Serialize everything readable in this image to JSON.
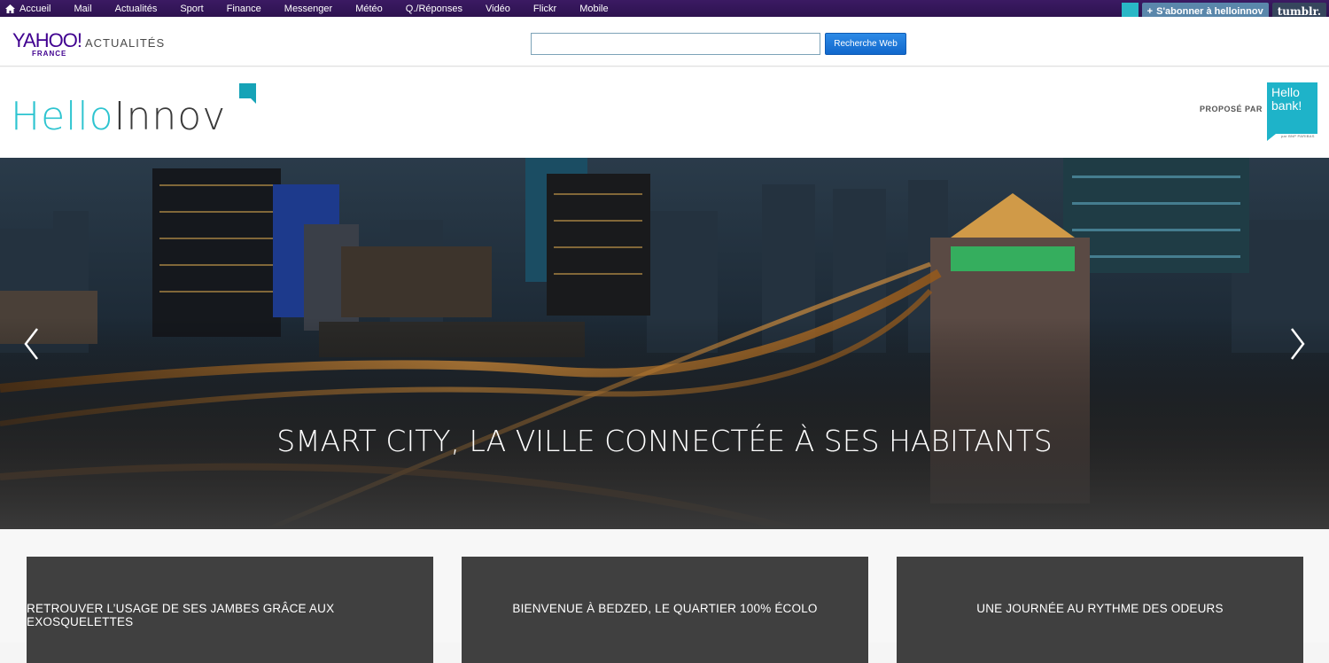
{
  "topnav": {
    "items": [
      "Accueil",
      "Mail",
      "Actualités",
      "Sport",
      "Finance",
      "Messenger",
      "Météo",
      "Q./Réponses",
      "Vidéo",
      "Flickr",
      "Mobile"
    ],
    "subscribe_label": "S'abonner à helloinnov",
    "tumblr_label": "tumblr."
  },
  "yahoo": {
    "logo": "YAHOO!",
    "section": "ACTUALITÉS",
    "country": "FRANCE",
    "search_value": "",
    "search_button": "Recherche Web"
  },
  "brand": {
    "hello": "Hello",
    "innov": "Innov",
    "proposed_by": "PROPOSÉ PAR",
    "partner_line1": "Hello",
    "partner_line2": "bank!",
    "partner_sub": "par BNP PARIBAS"
  },
  "hero": {
    "title": "SMART CITY, LA VILLE CONNECTÉE À SES HABITANTS"
  },
  "cards": [
    {
      "title": "RETROUVER L’USAGE DE SES JAMBES GRÂCE AUX EXOSQUELETTES"
    },
    {
      "title": "BIENVENUE À BEDZED, LE QUARTIER 100% ÉCOLO"
    },
    {
      "title": "UNE JOURNÉE AU RYTHME DES ODEURS"
    }
  ],
  "colors": {
    "topbar": "#2d124f",
    "yahoo_purple": "#400090",
    "brand_teal": "#2ec4d0",
    "card_bg": "#404040",
    "search_button": "#1168cc"
  },
  "icons": [
    "home-icon",
    "tumblr-chat-icon",
    "chevron-left-icon",
    "chevron-right-icon"
  ]
}
